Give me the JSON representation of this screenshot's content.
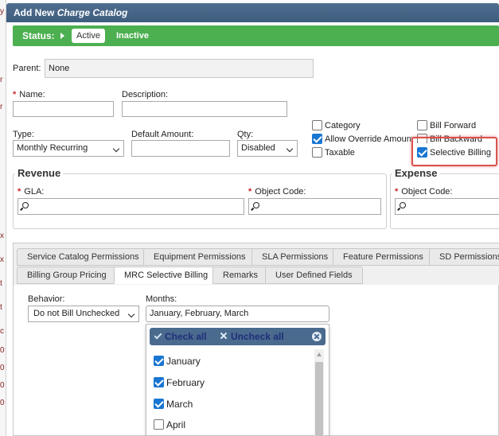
{
  "dialog": {
    "title_prefix": "Add New",
    "title_emphasis": "Charge Catalog"
  },
  "status": {
    "label": "Status:",
    "active": "Active",
    "inactive": "Inactive"
  },
  "form": {
    "parent_label": "Parent:",
    "parent_value": "None",
    "name_label": "Name:",
    "name_value": "",
    "description_label": "Description:",
    "description_value": "",
    "type_label": "Type:",
    "type_value": "Monthly Recurring",
    "default_amount_label": "Default Amount:",
    "default_amount_value": "",
    "qty_label": "Qty:",
    "qty_value": "Disabled",
    "required_marker": "*"
  },
  "options": {
    "category": {
      "label": "Category",
      "checked": false
    },
    "allow_override": {
      "label": "Allow Override Amount",
      "checked": true
    },
    "taxable": {
      "label": "Taxable",
      "checked": false
    },
    "bill_forward": {
      "label": "Bill Forward",
      "checked": false
    },
    "bill_backward": {
      "label": "Bill Backward",
      "checked": false
    },
    "selective_billing": {
      "label": "Selective Billing",
      "checked": true
    }
  },
  "revenue": {
    "title": "Revenue",
    "gla_label": "GLA:",
    "object_code_label": "Object Code:"
  },
  "expense": {
    "title": "Expense",
    "object_code_label": "Object Code:"
  },
  "tabs": {
    "row1": [
      "Service Catalog Permissions",
      "Equipment Permissions",
      "SLA Permissions",
      "Feature Permissions",
      "SD Permissions"
    ],
    "row2": [
      "Billing Group Pricing",
      "MRC Selective Billing",
      "Remarks",
      "User Defined Fields"
    ],
    "active": "MRC Selective Billing"
  },
  "billing": {
    "behavior_label": "Behavior:",
    "behavior_value": "Do not Bill Unchecked",
    "months_label": "Months:",
    "months_value": "January, February, March",
    "check_all": "Check all",
    "uncheck_all": "Uncheck all",
    "months": [
      {
        "name": "January",
        "checked": true
      },
      {
        "name": "February",
        "checked": true
      },
      {
        "name": "March",
        "checked": true
      },
      {
        "name": "April",
        "checked": false
      }
    ]
  },
  "edge_markers": [
    "y",
    "r",
    "r",
    "x",
    "x",
    "t",
    "t",
    "c",
    "0",
    "0",
    "0",
    "0"
  ],
  "colors": {
    "titlebar": "#4f6e8f",
    "status_bar": "#4caf50",
    "highlight": "#d9534f",
    "checkbox_checked": "#1976d2",
    "dropdown_header": "#4a6a8e"
  }
}
